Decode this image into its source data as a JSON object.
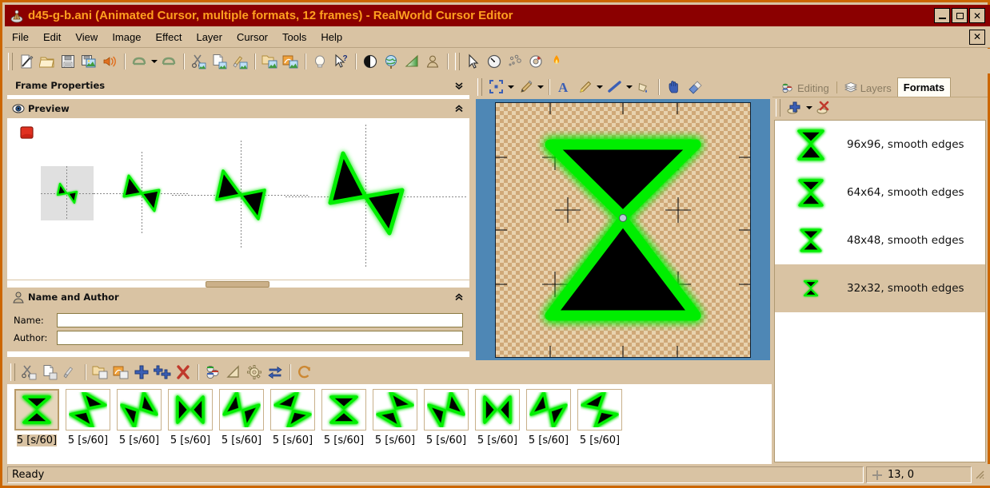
{
  "window": {
    "title": "d45-g-b.ani (Animated Cursor, multiple formats, 12 frames) - RealWorld Cursor Editor",
    "icon": "app-icon",
    "minimize_label": "_",
    "maximize_label": "▫",
    "close_label": "✕"
  },
  "menubar": {
    "items": [
      {
        "label": "File"
      },
      {
        "label": "Edit"
      },
      {
        "label": "View"
      },
      {
        "label": "Image"
      },
      {
        "label": "Effect"
      },
      {
        "label": "Layer"
      },
      {
        "label": "Cursor"
      },
      {
        "label": "Tools"
      },
      {
        "label": "Help"
      }
    ],
    "mdi_close_label": "✕"
  },
  "toolbar": {
    "groups": [
      {
        "buttons": [
          {
            "icon": "new-document-icon"
          },
          {
            "icon": "open-folder-icon"
          },
          {
            "icon": "save-disk-icon"
          },
          {
            "icon": "save-as-image-icon"
          },
          {
            "icon": "publish-sound-icon"
          }
        ]
      },
      {
        "buttons": [
          {
            "icon": "undo-icon",
            "has_dropdown": true
          },
          {
            "icon": "redo-icon"
          }
        ]
      },
      {
        "buttons": [
          {
            "icon": "cut-icon"
          },
          {
            "icon": "copy-icon"
          },
          {
            "icon": "paste-icon"
          }
        ]
      },
      {
        "buttons": [
          {
            "icon": "duplicate-image-icon"
          },
          {
            "icon": "image-effects-icon"
          }
        ]
      },
      {
        "buttons": [
          {
            "icon": "light-bulb-icon"
          },
          {
            "icon": "whats-this-help-icon"
          }
        ]
      },
      {
        "buttons": [
          {
            "icon": "contrast-icon"
          },
          {
            "icon": "globe-icon"
          },
          {
            "icon": "gradient-icon"
          },
          {
            "icon": "person-icon"
          }
        ]
      },
      {
        "buttons": [
          {
            "icon": "pointer-arrow-icon"
          },
          {
            "icon": "clock-icon"
          },
          {
            "icon": "particles-icon"
          },
          {
            "icon": "lifebuoy-icon"
          },
          {
            "icon": "flame-icon"
          }
        ]
      }
    ]
  },
  "left_dock": {
    "frame_properties": {
      "title": "Frame Properties",
      "collapse_icon": "chevron-double-down-icon",
      "collapsed": true
    },
    "preview": {
      "title": "Preview",
      "icon": "eye-icon",
      "collapse_icon": "chevron-double-up-icon",
      "stop_button_icon": "stop-record-icon",
      "sizes": [
        32,
        48,
        64,
        96
      ]
    },
    "name_and_author": {
      "title": "Name and Author",
      "icon": "person-icon",
      "collapse_icon": "chevron-double-up-icon",
      "fields": [
        {
          "label": "Name:",
          "value": "",
          "placeholder": ""
        },
        {
          "label": "Author:",
          "value": "",
          "placeholder": ""
        }
      ]
    }
  },
  "canvas_toolbar": {
    "buttons": [
      {
        "icon": "selection-tool-icon",
        "has_dropdown": true
      },
      {
        "icon": "pencil-tool-icon",
        "has_dropdown": true
      },
      {
        "icon": "text-tool-icon"
      },
      {
        "icon": "brush-tool-icon",
        "has_dropdown": true
      },
      {
        "icon": "line-tool-icon",
        "has_dropdown": true
      },
      {
        "icon": "fill-bucket-icon"
      },
      {
        "icon": "hand-pan-icon"
      },
      {
        "icon": "eraser-icon"
      }
    ],
    "overflow_label": "»"
  },
  "canvas": {
    "image_name": "hourglass-cursor-32x32",
    "background": "#4e87b5",
    "hotspot_label": "hotspot-marker"
  },
  "right_dock": {
    "tabs": [
      {
        "label": "Editing",
        "icon": "palette-icon",
        "active": false
      },
      {
        "label": "Layers",
        "icon": "layers-icon",
        "active": false
      },
      {
        "label": "Formats",
        "icon": "",
        "active": true
      }
    ],
    "toolbar": [
      {
        "icon": "add-format-icon",
        "has_dropdown": true
      },
      {
        "icon": "delete-format-icon"
      }
    ],
    "formats": [
      {
        "label": "96x96, smooth edges",
        "size": 96,
        "selected": false
      },
      {
        "label": "64x64, smooth edges",
        "size": 64,
        "selected": false
      },
      {
        "label": "48x48, smooth edges",
        "size": 48,
        "selected": false
      },
      {
        "label": "32x32, smooth edges",
        "size": 32,
        "selected": true
      }
    ]
  },
  "frame_strip": {
    "toolbar": [
      {
        "icon": "cut-frame-icon"
      },
      {
        "icon": "copy-frame-icon"
      },
      {
        "icon": "paste-frame-icon"
      },
      {
        "icon": "duplicate-frame-icon"
      },
      {
        "icon": "import-frame-icon"
      },
      {
        "icon": "add-frame-icon"
      },
      {
        "icon": "add-multiple-frames-icon"
      },
      {
        "icon": "delete-frame-icon"
      },
      {
        "icon": "frame-colors-icon"
      },
      {
        "icon": "frame-transform-icon"
      },
      {
        "icon": "frame-settings-icon"
      },
      {
        "icon": "reorder-frames-icon"
      },
      {
        "icon": "reload-frames-icon"
      }
    ],
    "frames": [
      {
        "label": "5 [s/60]",
        "rotation": 0,
        "selected": true
      },
      {
        "label": "5 [s/60]",
        "rotation": 30,
        "selected": false
      },
      {
        "label": "5 [s/60]",
        "rotation": 60,
        "selected": false
      },
      {
        "label": "5 [s/60]",
        "rotation": 90,
        "selected": false
      },
      {
        "label": "5 [s/60]",
        "rotation": 120,
        "selected": false
      },
      {
        "label": "5 [s/60]",
        "rotation": 150,
        "selected": false
      },
      {
        "label": "5 [s/60]",
        "rotation": 180,
        "selected": false
      },
      {
        "label": "5 [s/60]",
        "rotation": 210,
        "selected": false
      },
      {
        "label": "5 [s/60]",
        "rotation": 240,
        "selected": false
      },
      {
        "label": "5 [s/60]",
        "rotation": 270,
        "selected": false
      },
      {
        "label": "5 [s/60]",
        "rotation": 300,
        "selected": false
      },
      {
        "label": "5 [s/60]",
        "rotation": 330,
        "selected": false
      }
    ]
  },
  "statusbar": {
    "message": "Ready",
    "coordinates": "13, 0",
    "coordinates_icon": "crosshair-icon",
    "resize_grip_icon": "resize-grip-icon"
  },
  "colors": {
    "titlebar": "#8b0000",
    "title_text": "#ffa020",
    "window_frame": "#cc6600",
    "chrome": "#d9c3a3",
    "canvas_bg": "#4e87b5",
    "cursor_glow": "#00ee00",
    "cursor_body": "#000000"
  }
}
